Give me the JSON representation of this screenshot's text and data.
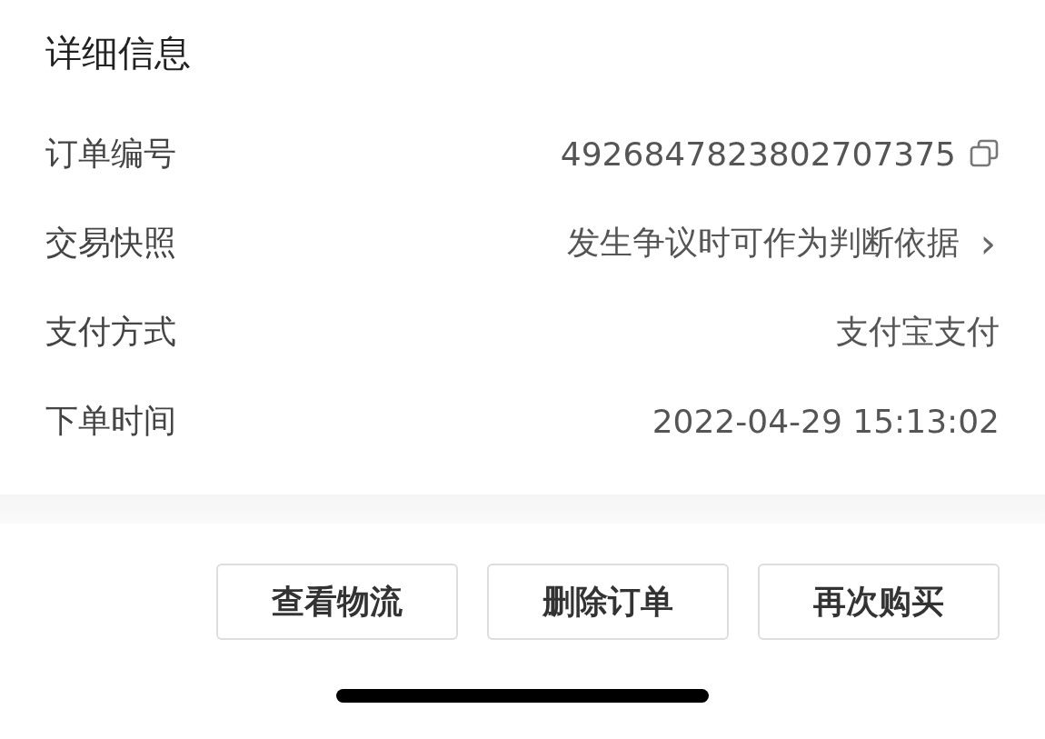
{
  "section": {
    "title": "详细信息"
  },
  "rows": [
    {
      "kind": "copy",
      "label": "订单编号",
      "value": "4926847823802707375"
    },
    {
      "kind": "link",
      "label": "交易快照",
      "value": "发生争议时可作为判断依据",
      "chevron": "›"
    },
    {
      "kind": "plain",
      "label": "支付方式",
      "value": "支付宝支付"
    },
    {
      "kind": "plain",
      "label": "下单时间",
      "value": "2022-04-29 15:13:02"
    }
  ],
  "buttons": [
    "查看物流",
    "删除订单",
    "再次购买"
  ]
}
